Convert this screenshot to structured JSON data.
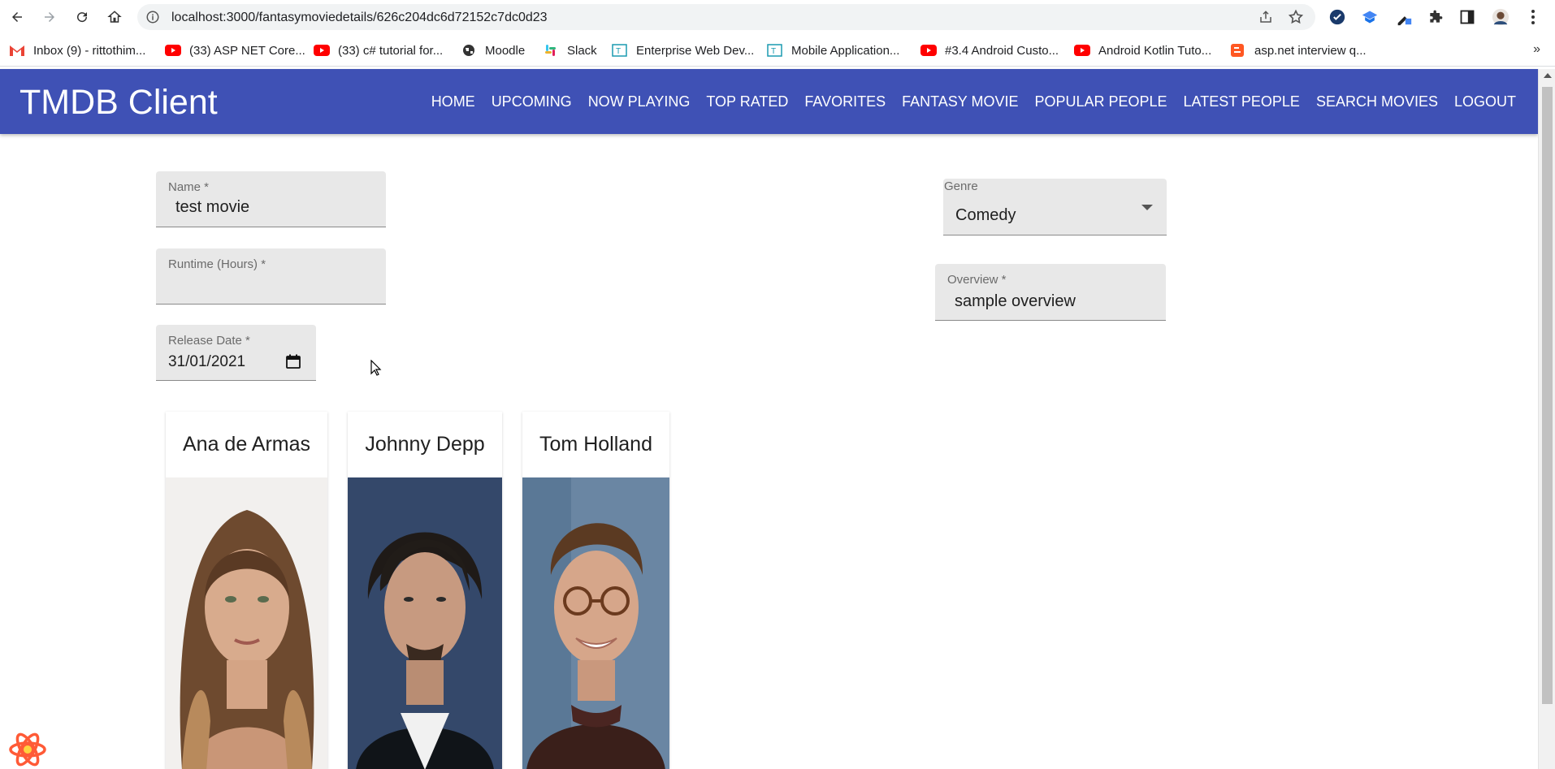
{
  "browser": {
    "url": "localhost:3000/fantasymoviedetails/626c204dc6d72152c7dc0d23",
    "bookmarks": [
      {
        "label": "Inbox (9) - rittothim...",
        "icon": "gmail-icon"
      },
      {
        "label": "(33) ASP NET Core...",
        "icon": "youtube-icon"
      },
      {
        "label": "(33) c# tutorial for...",
        "icon": "youtube-icon"
      },
      {
        "label": "Moodle",
        "icon": "globe-icon"
      },
      {
        "label": "Slack",
        "icon": "slack-icon"
      },
      {
        "label": "Enterprise Web Dev...",
        "icon": "bookmark-t-icon"
      },
      {
        "label": "Mobile Application...",
        "icon": "bookmark-t-icon"
      },
      {
        "label": "#3.4 Android Custo...",
        "icon": "youtube-icon"
      },
      {
        "label": "Android Kotlin Tuto...",
        "icon": "youtube-icon"
      },
      {
        "label": "asp.net interview q...",
        "icon": "blogger-icon"
      }
    ],
    "more_bookmarks": "»"
  },
  "app": {
    "title": "TMDB Client",
    "nav": [
      "HOME",
      "UPCOMING",
      "NOW PLAYING",
      "TOP RATED",
      "FAVORITES",
      "FANTASY MOVIE",
      "POPULAR PEOPLE",
      "LATEST PEOPLE",
      "SEARCH MOVIES",
      "LOGOUT"
    ],
    "accent_color": "#3f51b5"
  },
  "form": {
    "name": {
      "label": "Name *",
      "value": "test movie"
    },
    "runtime": {
      "label": "Runtime (Hours) *",
      "value": ""
    },
    "release_date": {
      "label": "Release Date *",
      "value": "31/01/2021"
    },
    "genre": {
      "label": "Genre",
      "value": "Comedy"
    },
    "overview": {
      "label": "Overview *",
      "value": "sample overview"
    }
  },
  "actors": [
    {
      "name": "Ana de Armas"
    },
    {
      "name": "Johnny Depp"
    },
    {
      "name": "Tom Holland"
    }
  ]
}
